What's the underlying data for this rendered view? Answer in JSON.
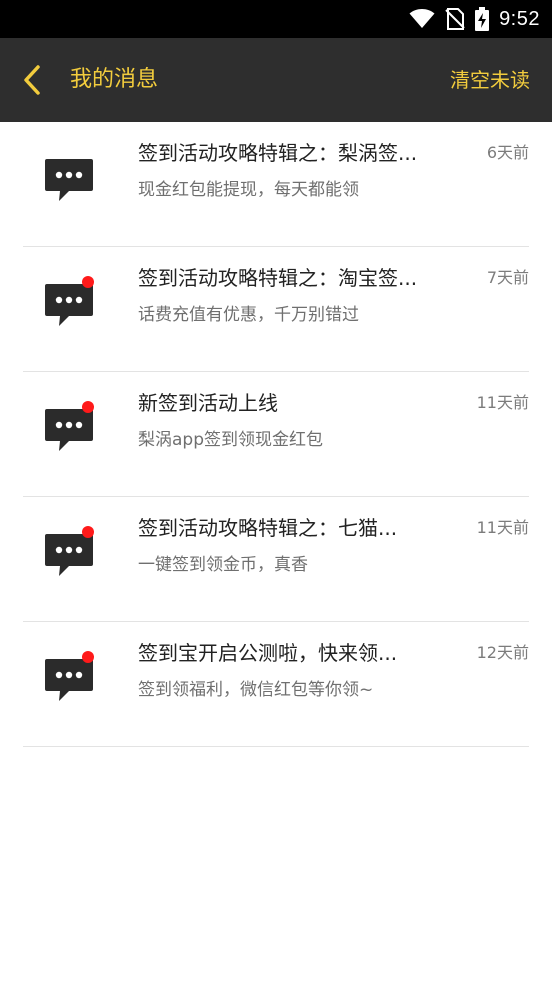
{
  "status_bar": {
    "time": "9:52",
    "icons": [
      "wifi-icon",
      "no-sim-icon",
      "battery-charging-icon"
    ]
  },
  "header": {
    "back_icon": "chevron-left-icon",
    "title": "我的消息",
    "action_label": "清空未读",
    "accent_color": "#f2cc3d",
    "background": "#2e2e2e"
  },
  "messages": [
    {
      "title": "签到活动攻略特辑之：梨涡签...",
      "subtitle": "现金红包能提现，每天都能领",
      "time": "6天前",
      "unread": false
    },
    {
      "title": "签到活动攻略特辑之：淘宝签...",
      "subtitle": "话费充值有优惠，千万别错过",
      "time": "7天前",
      "unread": true
    },
    {
      "title": "新签到活动上线",
      "subtitle": "梨涡app签到领现金红包",
      "time": "11天前",
      "unread": true
    },
    {
      "title": "签到活动攻略特辑之：七猫...",
      "subtitle": "一键签到领金币，真香",
      "time": "11天前",
      "unread": true
    },
    {
      "title": "签到宝开启公测啦，快来领...",
      "subtitle": "签到领福利，微信红包等你领~",
      "time": "12天前",
      "unread": true
    }
  ],
  "message_icon": "chat-bubble-icon",
  "unread_color": "#ff1a1a"
}
